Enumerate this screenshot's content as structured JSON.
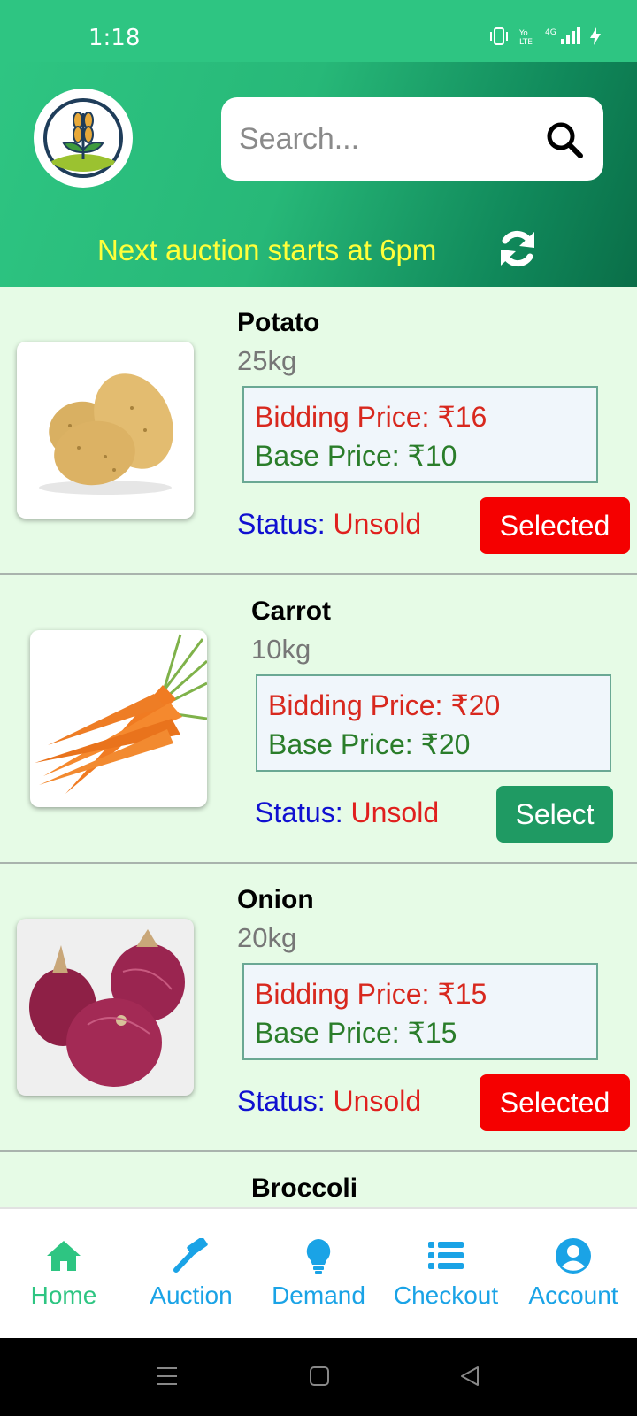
{
  "status_bar": {
    "time": "1:18",
    "network": "4G"
  },
  "header": {
    "search_placeholder": "Search...",
    "auction_note": "Next auction starts at 6pm"
  },
  "products": [
    {
      "name": "Potato",
      "qty": "25kg",
      "bidding_price": "Bidding Price: ₹16",
      "base_price": "Base Price: ₹10",
      "status_label": "Status: ",
      "status_value": "Unsold",
      "button": "Selected"
    },
    {
      "name": "Carrot",
      "qty": "10kg",
      "bidding_price": "Bidding Price: ₹20",
      "base_price": "Base Price: ₹20",
      "status_label": "Status: ",
      "status_value": "Unsold",
      "button": "Select"
    },
    {
      "name": "Onion",
      "qty": "20kg",
      "bidding_price": "Bidding Price: ₹15",
      "base_price": "Base Price: ₹15",
      "status_label": "Status: ",
      "status_value": "Unsold",
      "button": "Selected"
    },
    {
      "name": "Broccoli"
    }
  ],
  "bottom_nav": [
    {
      "label": "Home",
      "icon": "home-icon",
      "color": "#2ec582"
    },
    {
      "label": "Auction",
      "icon": "gavel-icon",
      "color": "#1aa3e6"
    },
    {
      "label": "Demand",
      "icon": "lightbulb-icon",
      "color": "#1aa3e6"
    },
    {
      "label": "Checkout",
      "icon": "list-icon",
      "color": "#1aa3e6"
    },
    {
      "label": "Account",
      "icon": "user-circle-icon",
      "color": "#1aa3e6"
    }
  ],
  "colors": {
    "primary": "#2ec582",
    "selected": "#f50000",
    "select": "#1f9a63"
  }
}
